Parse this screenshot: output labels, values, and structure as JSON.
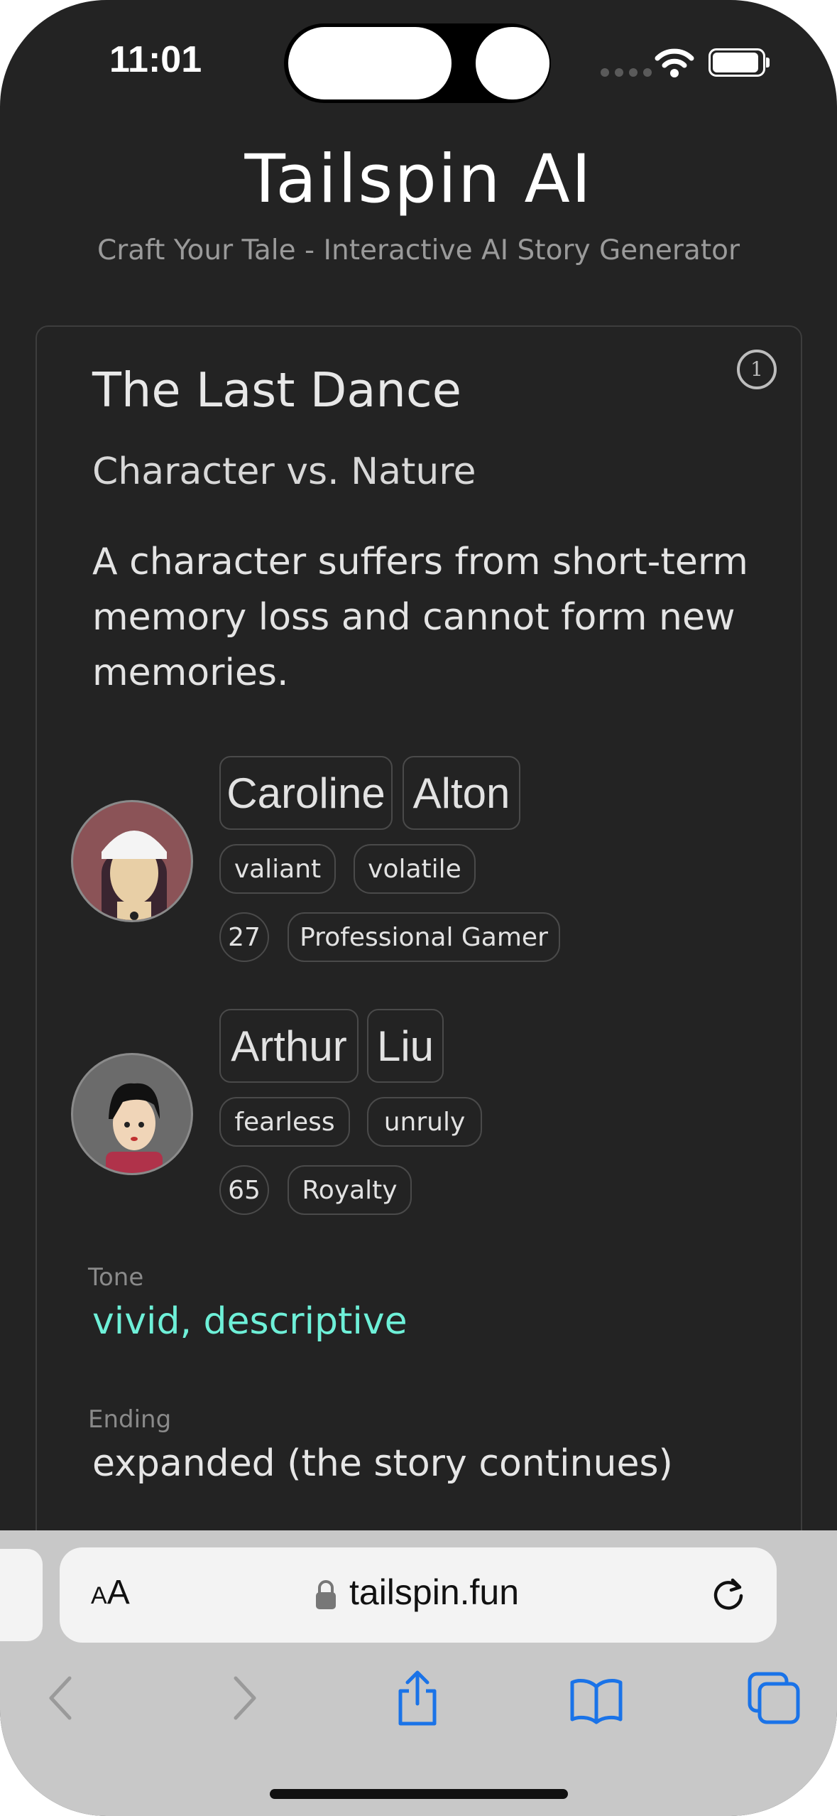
{
  "status_bar": {
    "time": "11:01"
  },
  "header": {
    "title": "Tailspin AI",
    "subtitle": "Craft Your Tale - Interactive AI Story Generator"
  },
  "story": {
    "badge": "1",
    "title": "The Last Dance",
    "conflict": "Character vs. Nature",
    "premise": "A character suffers from short-term memory loss and cannot form new memories.",
    "characters": [
      {
        "first_name": "Caroline",
        "last_name": "Alton",
        "traits": [
          "valiant",
          "volatile"
        ],
        "age": "27",
        "occupation": "Professional Gamer"
      },
      {
        "first_name": "Arthur",
        "last_name": "Liu",
        "traits": [
          "fearless",
          "unruly"
        ],
        "age": "65",
        "occupation": "Royalty"
      }
    ],
    "tone_label": "Tone",
    "tone_value": "vivid, descriptive",
    "ending_label": "Ending",
    "ending_value": "expanded (the story continues)"
  },
  "browser": {
    "aa_small": "A",
    "aa_big": "A",
    "url": "tailspin.fun"
  },
  "colors": {
    "background": "#232323",
    "tone_accent": "#6ef0d8",
    "safari_blue": "#1a73e8"
  }
}
